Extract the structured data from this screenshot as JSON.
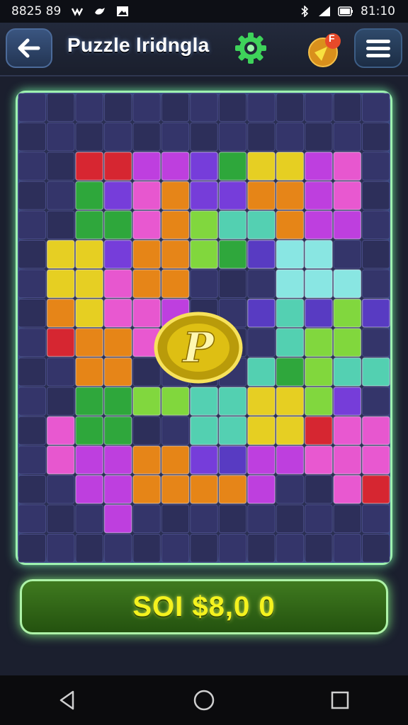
{
  "status_bar": {
    "time_left": "8825 89",
    "time_right": "81:10",
    "icons": [
      "game-controller-icon",
      "bird-icon",
      "image-icon",
      "bluetooth-icon",
      "signal-icon",
      "battery-icon"
    ]
  },
  "header": {
    "title": "Puzzle lridngla",
    "back_icon": "back-arrow-icon",
    "settings_icon": "gear-icon",
    "reward_icon": "reward-badge-icon",
    "reward_badge_text": "F",
    "menu_icon": "hamburger-menu-icon"
  },
  "board": {
    "grid_rows": 16,
    "grid_cols": 13,
    "center_emblem": "P",
    "colors": {
      "red": "#e0262f",
      "magenta": "#c640e6",
      "pink": "#f25ad6",
      "orange": "#f08a14",
      "yellow": "#f0d820",
      "green": "#2fae3a",
      "lime": "#86e03c",
      "teal": "#56d9b6",
      "cyan": "#8ef0ea",
      "purple": "#7a3ee0",
      "violet": "#5b3cc8"
    }
  },
  "score": {
    "text": "SOI  $8,0 0"
  },
  "nav": {
    "back": "nav-back-icon",
    "home": "nav-home-icon",
    "recents": "nav-recents-icon"
  }
}
